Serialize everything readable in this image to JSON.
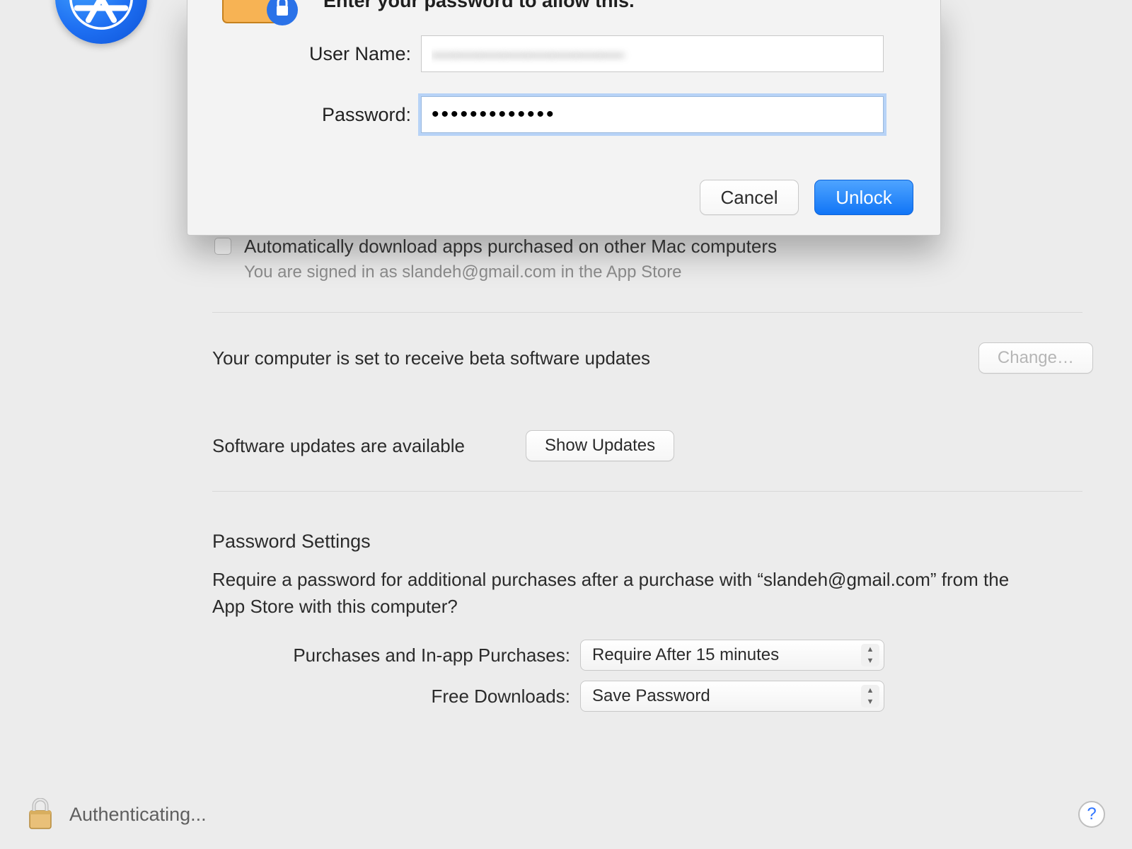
{
  "dialog": {
    "prompt": "Enter your password to allow this.",
    "username_label": "User Name:",
    "username_value": "————————",
    "password_label": "Password:",
    "password_value": "•••••••••••••",
    "cancel": "Cancel",
    "unlock": "Unlock"
  },
  "prefs": {
    "auto_dl_label": "Automatically download apps purchased on other Mac computers",
    "signed_in": "You are signed in as slandeh@gmail.com in the App Store",
    "beta_text": "Your computer is set to receive beta software updates",
    "change_btn": "Change…",
    "updates_text": "Software updates are available",
    "show_updates": "Show Updates",
    "pw_section": "Password Settings",
    "pw_desc": "Require a password for additional purchases after a purchase with “slandeh@gmail.com” from the App Store with this computer?",
    "purchases_label": "Purchases and In-app Purchases:",
    "purchases_value": "Require After 15 minutes",
    "free_label": "Free Downloads:",
    "free_value": "Save Password"
  },
  "footer": {
    "status": "Authenticating...",
    "help": "?"
  }
}
